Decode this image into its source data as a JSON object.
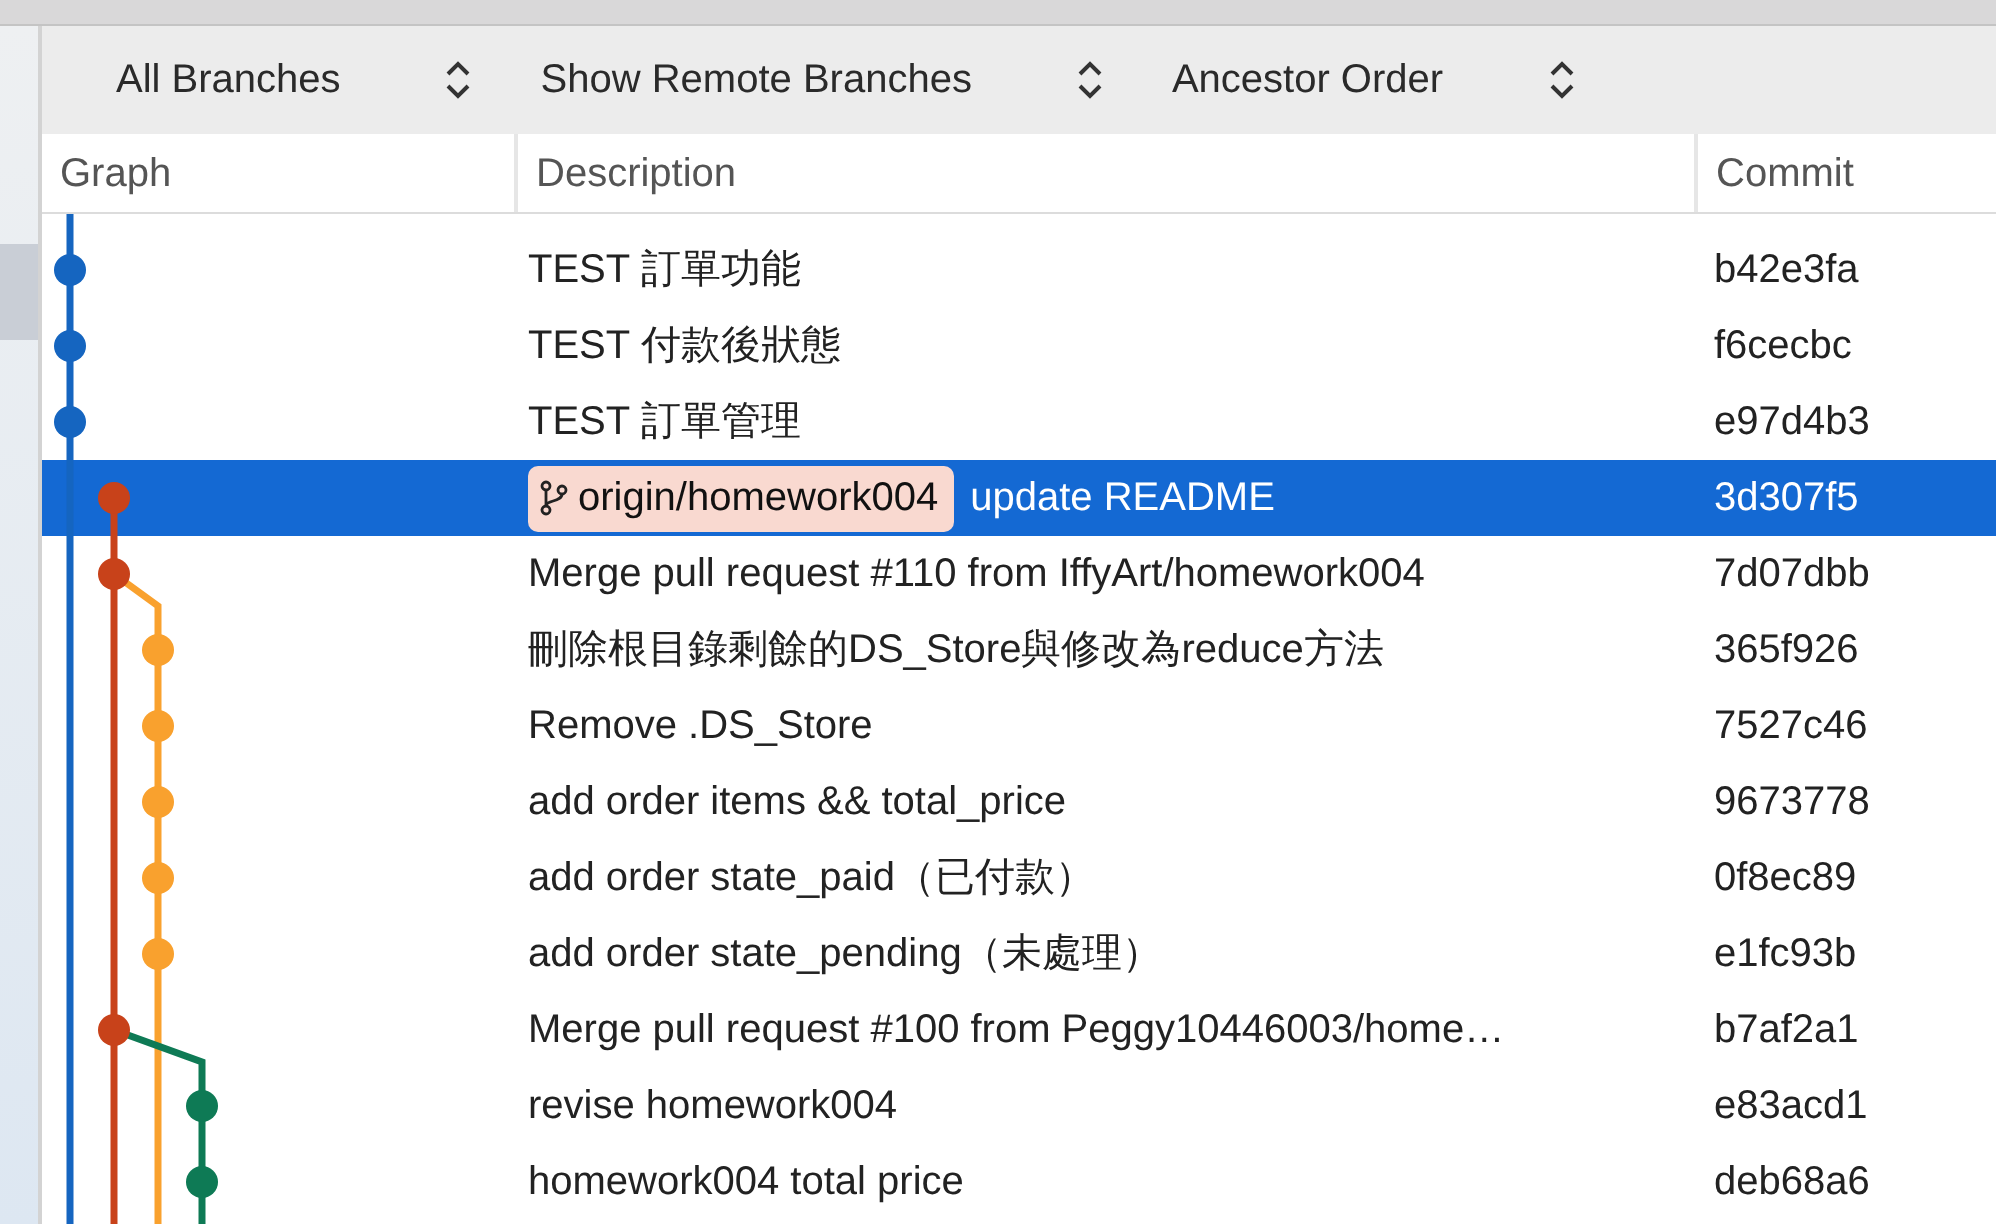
{
  "toolbar": {
    "popups": [
      {
        "label": "All Branches"
      },
      {
        "label": "Show Remote Branches"
      },
      {
        "label": "Ancestor Order"
      }
    ]
  },
  "table": {
    "columns": [
      "Graph",
      "Description",
      "Commit"
    ],
    "rows": [
      {
        "description": "TEST 訂單功能",
        "commit": "b42e3fa",
        "selected": false,
        "color": "#1565c0",
        "merge": false
      },
      {
        "description": "TEST 付款後狀態",
        "commit": "f6cecbc",
        "selected": false,
        "color": "#1565c0",
        "merge": false
      },
      {
        "description": "TEST 訂單管理",
        "commit": "e97d4b3",
        "selected": false,
        "color": "#1565c0",
        "merge": false
      },
      {
        "description": "update README",
        "commit": "3d307f5",
        "selected": true,
        "color": "#c8421a",
        "merge": false,
        "tags": [
          {
            "label": "origin/homework004"
          }
        ]
      },
      {
        "description": "Merge pull request #110 from IffyArt/homework004",
        "commit": "7d07dbb",
        "selected": false,
        "color": "#c8421a",
        "merge": true
      },
      {
        "description": "刪除根目錄剩餘的DS_Store與修改為reduce方法",
        "commit": "365f926",
        "selected": false,
        "color": "#f9a12e",
        "merge": false
      },
      {
        "description": "Remove .DS_Store",
        "commit": "7527c46",
        "selected": false,
        "color": "#f9a12e",
        "merge": false
      },
      {
        "description": "add order items && total_price",
        "commit": "9673778",
        "selected": false,
        "color": "#f9a12e",
        "merge": false
      },
      {
        "description": "add order state_paid（已付款）",
        "commit": "0f8ec89",
        "selected": false,
        "color": "#f9a12e",
        "merge": false
      },
      {
        "description": "add order state_pending（未處理）",
        "commit": "e1fc93b",
        "selected": false,
        "color": "#f9a12e",
        "merge": false
      },
      {
        "description": "Merge pull request #100 from Peggy10446003/home…",
        "commit": "b7af2a1",
        "selected": false,
        "color": "#c8421a",
        "merge": true
      },
      {
        "description": "revise homework004",
        "commit": "e83acd1",
        "selected": false,
        "color": "#0e7a55",
        "merge": false
      },
      {
        "description": "homework004 total price",
        "commit": "deb68a6",
        "selected": false,
        "color": "#0e7a55",
        "merge": false
      }
    ]
  }
}
